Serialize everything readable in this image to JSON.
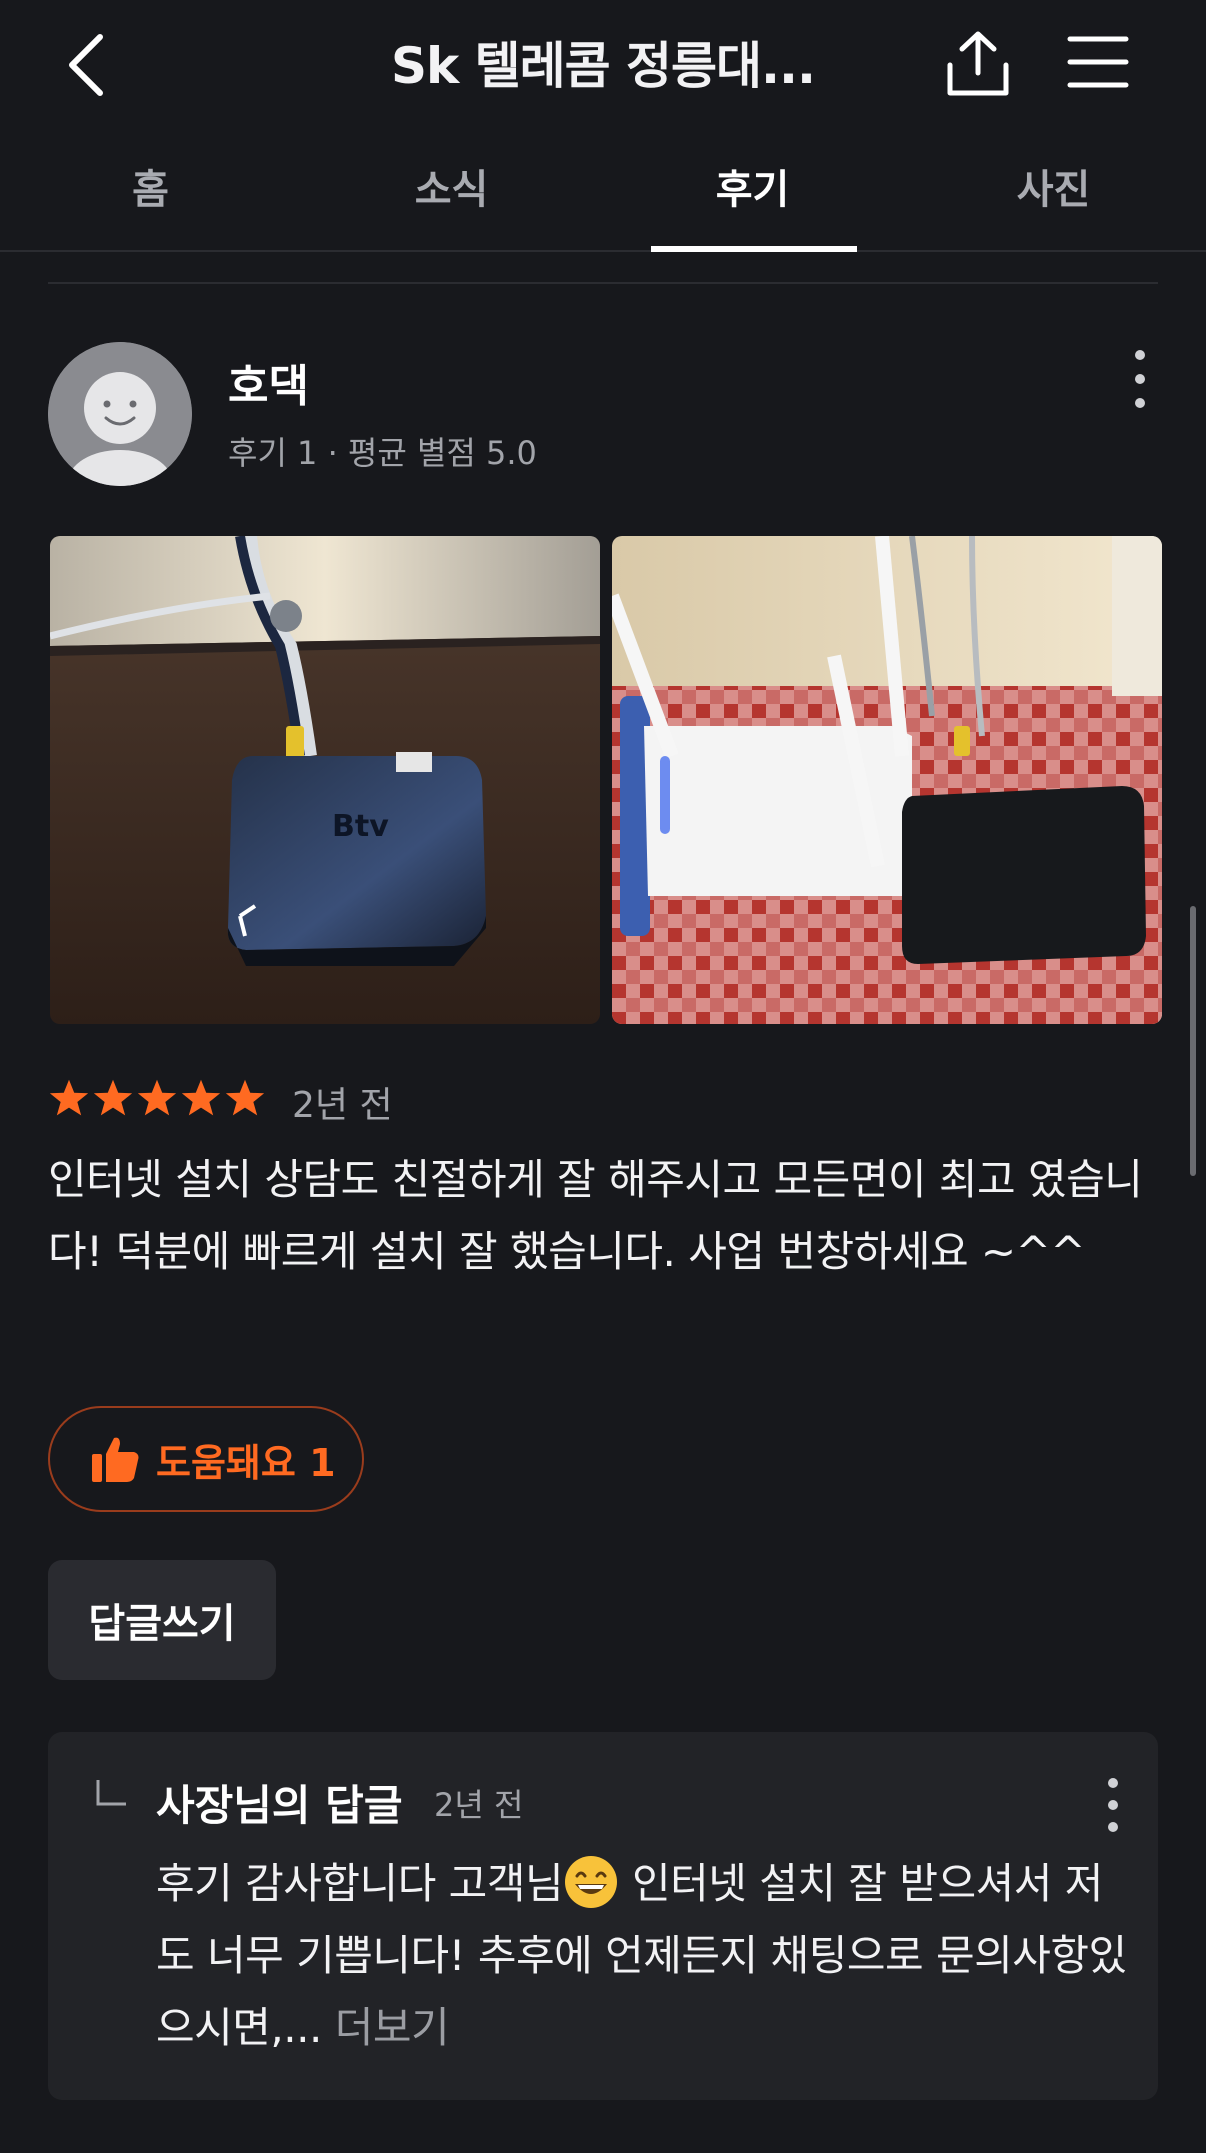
{
  "header": {
    "title": "Sk 텔레콤 정릉대...",
    "back_icon": "chevron-left-icon",
    "share_icon": "share-icon",
    "menu_icon": "hamburger-menu-icon"
  },
  "tabs": [
    {
      "label": "홈",
      "active": false
    },
    {
      "label": "소식",
      "active": false
    },
    {
      "label": "후기",
      "active": true
    },
    {
      "label": "사진",
      "active": false
    }
  ],
  "review": {
    "author": "호댁",
    "meta": "후기 1 · 평균 별점 5.0",
    "rating": 5,
    "date": "2년 전",
    "text": "인터넷 설치 상담도 친절하게 잘 해주시고 모든면이 최고 였습니다! 덕분에 빠르게 설치 잘 했습니다. 사업 번창하세요 ~^^",
    "helpful_label": "도움돼요 1",
    "reply_button": "답글쓰기"
  },
  "owner_reply": {
    "title": "사장님의 답글",
    "date": "2년 전",
    "text_before_emoji": "후기 감사합니다 고객님",
    "text_after_emoji": " 인터넷 설치 잘 받으셔서 저도 너무 기쁩니다! 추후에 언제든지 채팅으로 문의사항있으시면,...",
    "more": "더보기"
  },
  "colors": {
    "background": "#17181c",
    "accent": "#ff6a21",
    "star": "#ff6a21"
  }
}
